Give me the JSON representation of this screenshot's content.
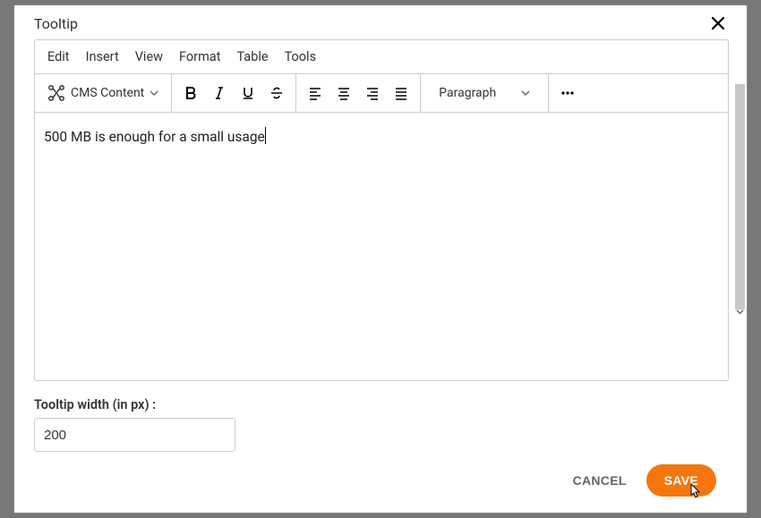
{
  "modal": {
    "title": "Tooltip"
  },
  "menubar": {
    "items": [
      "Edit",
      "Insert",
      "View",
      "Format",
      "Table",
      "Tools"
    ]
  },
  "toolbar": {
    "cms_label": "CMS Content",
    "paragraph_label": "Paragraph"
  },
  "editor": {
    "content": "500 MB is enough for a small usage"
  },
  "field": {
    "tooltip_width_label": "Tooltip width (in px) :",
    "tooltip_width_value": "200"
  },
  "footer": {
    "cancel_label": "CANCEL",
    "save_label": "SAVE"
  }
}
